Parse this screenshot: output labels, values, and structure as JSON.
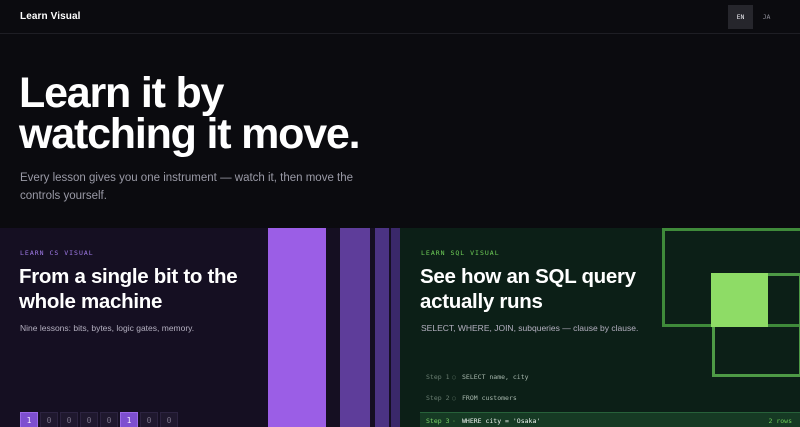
{
  "header": {
    "brand": "Learn Visual",
    "languages": [
      {
        "code": "EN",
        "active": true
      },
      {
        "code": "JA",
        "active": false
      }
    ]
  },
  "hero": {
    "title_line1": "Learn it by",
    "title_line2": "watching it move.",
    "subtitle": "Every lesson gives you one instrument — watch it, then move the controls yourself."
  },
  "cards": {
    "cs": {
      "eyebrow": "LEARN CS VISUAL",
      "title": "From a single bit to the whole machine",
      "description": "Nine lessons: bits, bytes, logic gates, memory.",
      "bits": [
        "1",
        "0",
        "0",
        "0",
        "0",
        "1",
        "0",
        "0"
      ],
      "bits_on": [
        true,
        false,
        false,
        false,
        false,
        true,
        false,
        false
      ],
      "accent_color": "#9b5ee6"
    },
    "sql": {
      "eyebrow": "LEARN SQL VISUAL",
      "title": "See how an SQL query actually runs",
      "description": "SELECT, WHERE, JOIN, subqueries — clause by clause.",
      "accent_color": "#8edc66",
      "steps": [
        {
          "label": "Step 1",
          "marker": "○",
          "code": "SELECT name, city"
        },
        {
          "label": "Step 2",
          "marker": "○",
          "code": "FROM customers"
        },
        {
          "label": "Step 3",
          "marker": "·",
          "code": "WHERE city = 'Osaka'",
          "rows": "2 rows"
        }
      ]
    }
  }
}
